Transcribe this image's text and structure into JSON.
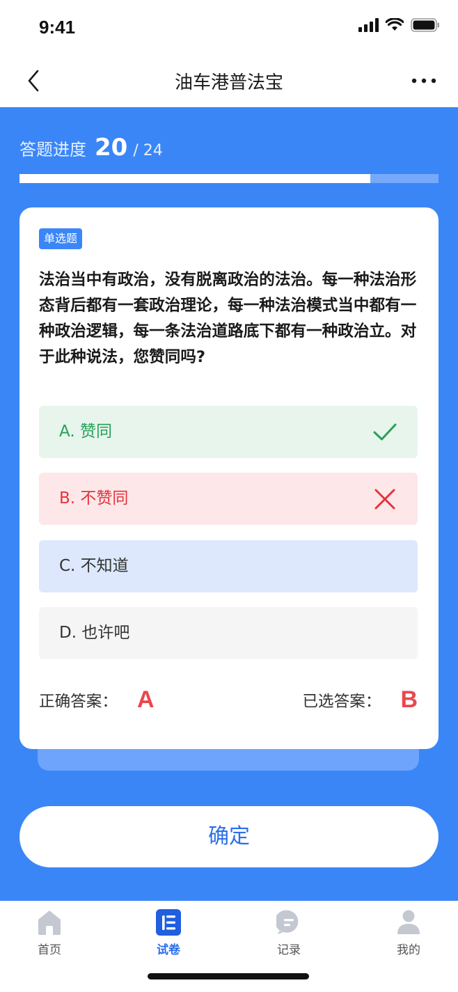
{
  "status_bar": {
    "time": "9:41"
  },
  "nav": {
    "title": "油车港普法宝",
    "back_icon": "chevron-left-icon",
    "more_icon": "more-dots-icon"
  },
  "progress": {
    "label": "答题进度",
    "current": "20",
    "total": "/ 24",
    "fraction": 0.838
  },
  "question": {
    "type_tag": "单选题",
    "text": "法治当中有政治，没有脱离政治的法治。每一种法治形态背后都有一套政治理论，每一种法治模式当中都有一种政治逻辑，每一条法治道路底下都有一种政治立。对于此种说法，您赞同吗?",
    "options": [
      {
        "label": "A. 赞同",
        "state": "correct",
        "icon": "check-icon"
      },
      {
        "label": "B. 不赞同",
        "state": "wrong",
        "icon": "cross-icon"
      },
      {
        "label": "C. 不知道",
        "state": "neutral"
      },
      {
        "label": "D. 也许吧",
        "state": "default"
      }
    ]
  },
  "answers": {
    "correct_label": "正确答案：",
    "correct_value": "A",
    "selected_label": "已选答案：",
    "selected_value": "B"
  },
  "confirm_label": "确定",
  "tabs": [
    {
      "label": "首页",
      "icon": "home-icon",
      "active": false
    },
    {
      "label": "试卷",
      "icon": "exam-list-icon",
      "active": true
    },
    {
      "label": "记录",
      "icon": "record-chat-icon",
      "active": false
    },
    {
      "label": "我的",
      "icon": "profile-icon",
      "active": false
    }
  ],
  "colors": {
    "primary": "#3a86f7",
    "correct": "#27a05a",
    "wrong": "#e5323c",
    "accent_text": "#2a6fe8"
  }
}
